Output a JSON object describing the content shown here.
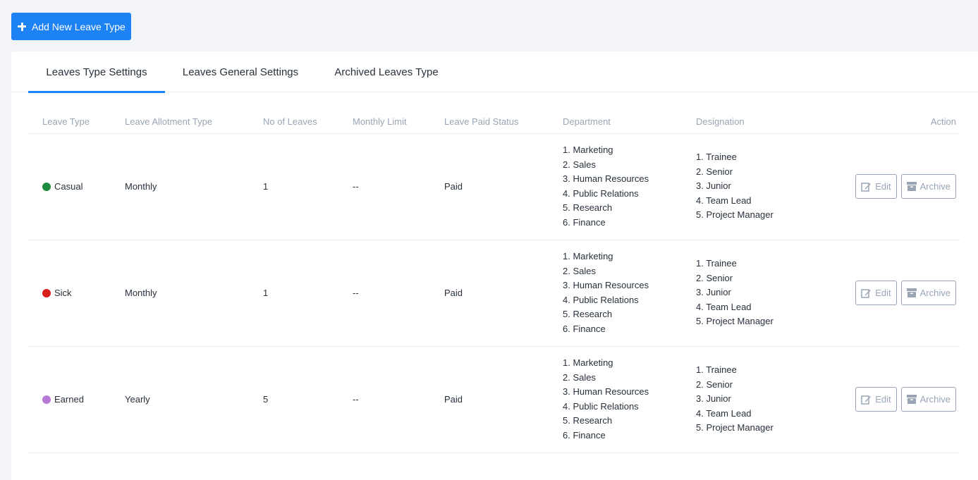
{
  "toolbar": {
    "add_label": "Add New Leave Type"
  },
  "tabs": [
    {
      "label": "Leaves Type Settings",
      "active": true
    },
    {
      "label": "Leaves General Settings",
      "active": false
    },
    {
      "label": "Archived Leaves Type",
      "active": false
    }
  ],
  "table": {
    "headers": [
      "Leave Type",
      "Leave Allotment Type",
      "No of Leaves",
      "Monthly Limit",
      "Leave Paid Status",
      "Department",
      "Designation",
      "Action"
    ],
    "edit_label": "Edit",
    "archive_label": "Archive",
    "rows": [
      {
        "name": "Casual",
        "color": "#1e8a3e",
        "allotment": "Monthly",
        "count": "1",
        "limit": "--",
        "paid": "Paid",
        "departments": [
          "1. Marketing",
          "2. Sales",
          "3. Human Resources",
          "4. Public Relations",
          "5. Research",
          "6. Finance"
        ],
        "designations": [
          "1. Trainee",
          "2. Senior",
          "3. Junior",
          "4. Team Lead",
          "5. Project Manager"
        ]
      },
      {
        "name": "Sick",
        "color": "#d91c1c",
        "allotment": "Monthly",
        "count": "1",
        "limit": "--",
        "paid": "Paid",
        "departments": [
          "1. Marketing",
          "2. Sales",
          "3. Human Resources",
          "4. Public Relations",
          "5. Research",
          "6. Finance"
        ],
        "designations": [
          "1. Trainee",
          "2. Senior",
          "3. Junior",
          "4. Team Lead",
          "5. Project Manager"
        ]
      },
      {
        "name": "Earned",
        "color": "#b779d6",
        "allotment": "Yearly",
        "count": "5",
        "limit": "--",
        "paid": "Paid",
        "departments": [
          "1. Marketing",
          "2. Sales",
          "3. Human Resources",
          "4. Public Relations",
          "5. Research",
          "6. Finance"
        ],
        "designations": [
          "1. Trainee",
          "2. Senior",
          "3. Junior",
          "4. Team Lead",
          "5. Project Manager"
        ]
      }
    ]
  },
  "icons": {
    "add": "plus-icon",
    "edit": "edit-icon",
    "archive": "archive-icon"
  }
}
